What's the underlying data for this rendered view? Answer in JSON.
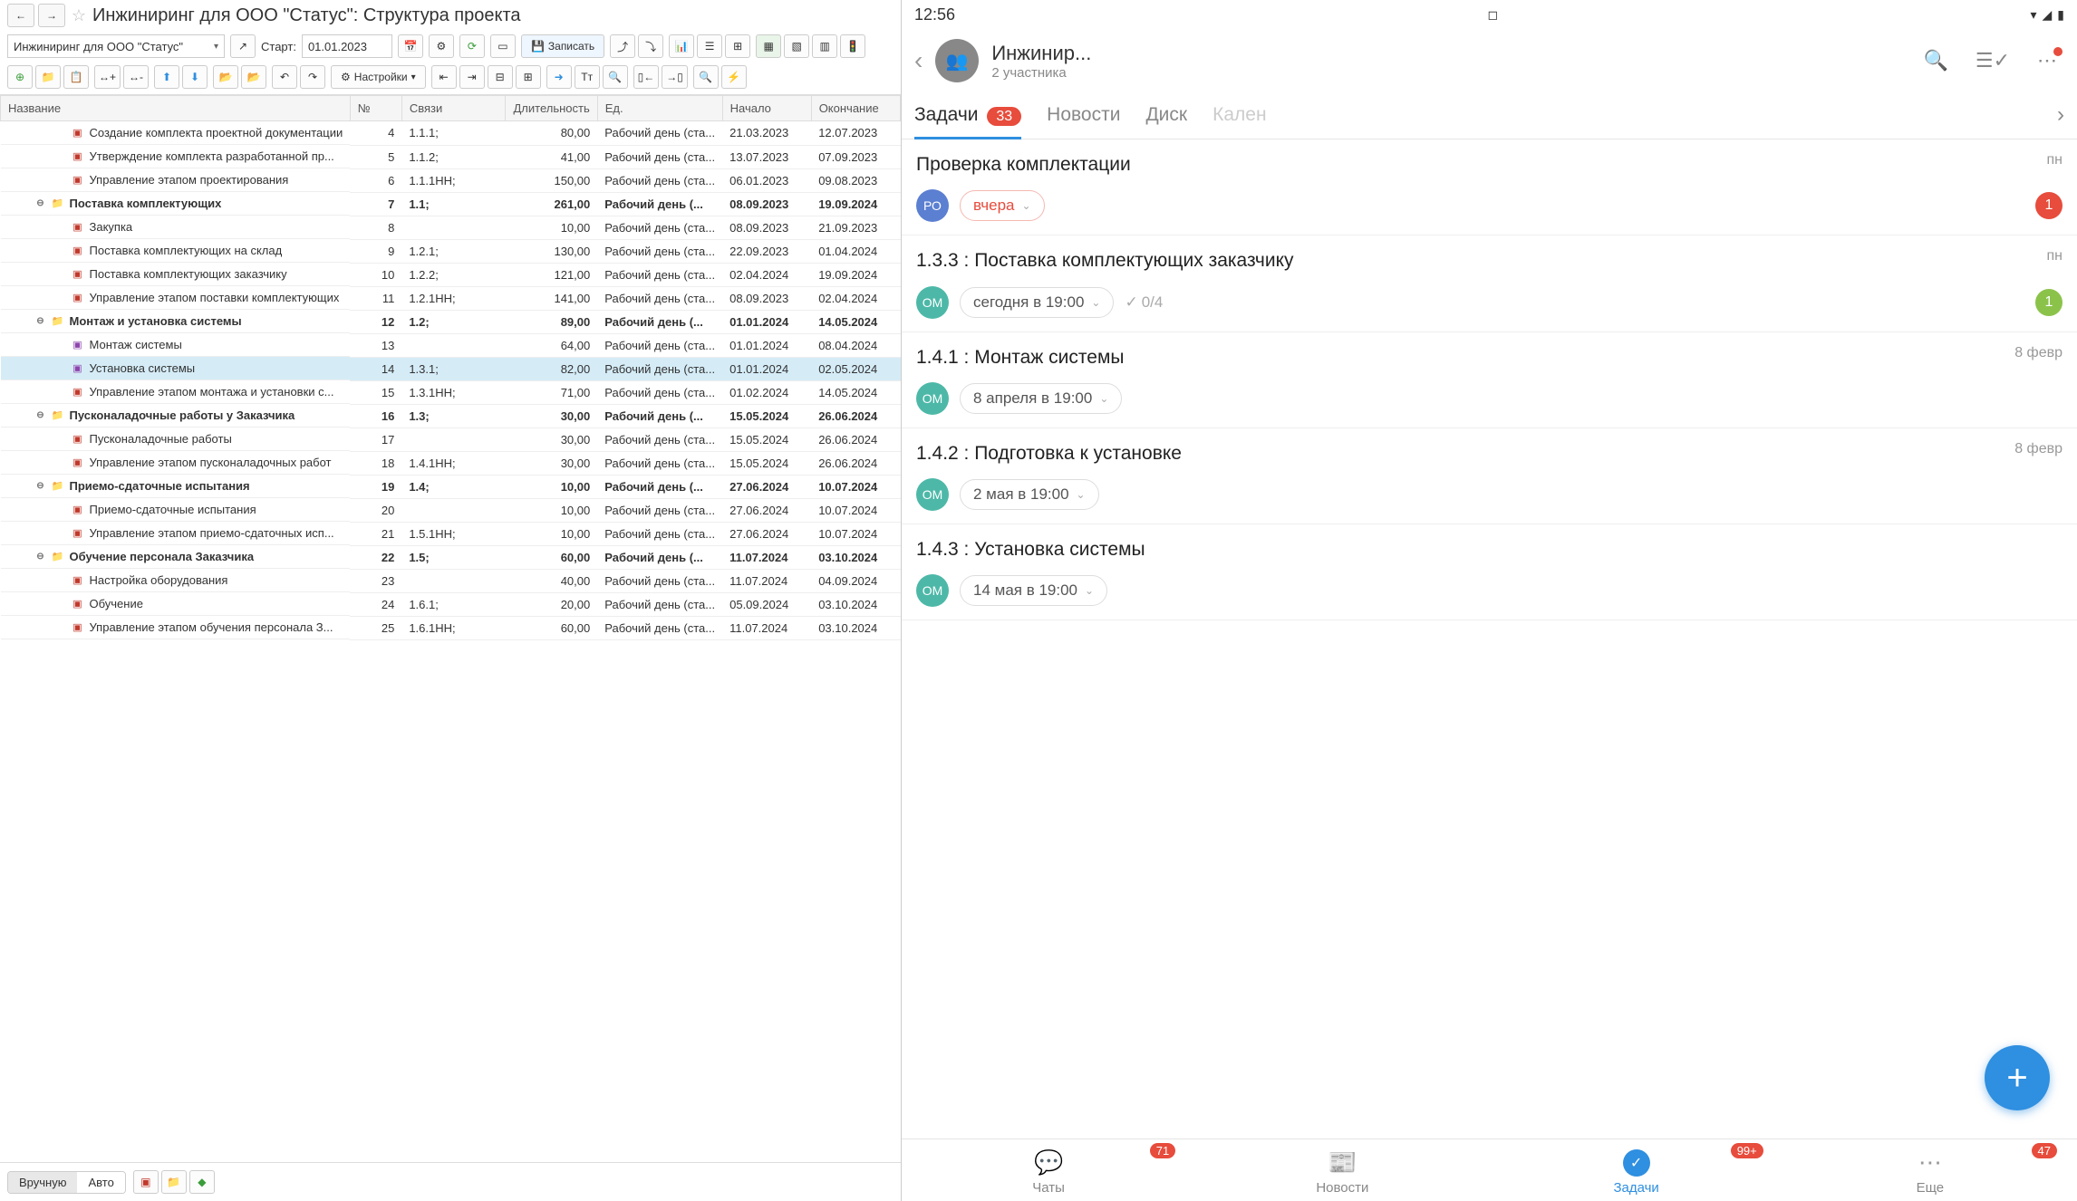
{
  "desktop": {
    "title": "Инжиниринг для ООО \"Статус\": Структура проекта",
    "project_select": "Инжиниринг для ООО \"Статус\"",
    "start_label": "Старт:",
    "start_date": "01.01.2023",
    "save_label": "Записать",
    "settings_label": "Настройки",
    "columns": {
      "name": "Название",
      "num": "№",
      "links": "Связи",
      "duration": "Длительность",
      "unit": "Ед.",
      "start": "Начало",
      "end": "Окончание"
    },
    "rows": [
      {
        "lvl": 2,
        "icon": "task",
        "name": "Создание комплекта проектной документации",
        "num": "4",
        "links": "1.1.1;",
        "dur": "80,00",
        "unit": "Рабочий день (ста...",
        "start": "21.03.2023",
        "end": "12.07.2023"
      },
      {
        "lvl": 2,
        "icon": "task",
        "name": "Утверждение комплекта разработанной пр...",
        "num": "5",
        "links": "1.1.2;",
        "dur": "41,00",
        "unit": "Рабочий день (ста...",
        "start": "13.07.2023",
        "end": "07.09.2023"
      },
      {
        "lvl": 2,
        "icon": "task",
        "name": "Управление этапом проектирования",
        "num": "6",
        "links": "1.1.1НН;",
        "dur": "150,00",
        "unit": "Рабочий день (ста...",
        "start": "06.01.2023",
        "end": "09.08.2023"
      },
      {
        "lvl": 1,
        "icon": "folder",
        "bold": true,
        "toggle": true,
        "name": "Поставка комплектующих",
        "num": "7",
        "links": "1.1;",
        "dur": "261,00",
        "unit": "Рабочий день (...",
        "start": "08.09.2023",
        "end": "19.09.2024"
      },
      {
        "lvl": 2,
        "icon": "task",
        "name": "Закупка",
        "num": "8",
        "links": "",
        "dur": "10,00",
        "unit": "Рабочий день (ста...",
        "start": "08.09.2023",
        "end": "21.09.2023"
      },
      {
        "lvl": 2,
        "icon": "task",
        "name": "Поставка комплектующих на склад",
        "num": "9",
        "links": "1.2.1;",
        "dur": "130,00",
        "unit": "Рабочий день (ста...",
        "start": "22.09.2023",
        "end": "01.04.2024"
      },
      {
        "lvl": 2,
        "icon": "task",
        "name": "Поставка комплектующих заказчику",
        "num": "10",
        "links": "1.2.2;",
        "dur": "121,00",
        "unit": "Рабочий день (ста...",
        "start": "02.04.2024",
        "end": "19.09.2024"
      },
      {
        "lvl": 2,
        "icon": "task",
        "name": "Управление этапом поставки комплектующих",
        "num": "11",
        "links": "1.2.1НН;",
        "dur": "141,00",
        "unit": "Рабочий день (ста...",
        "start": "08.09.2023",
        "end": "02.04.2024"
      },
      {
        "lvl": 1,
        "icon": "folder",
        "bold": true,
        "toggle": true,
        "name": "Монтаж и установка системы",
        "num": "12",
        "links": "1.2;",
        "dur": "89,00",
        "unit": "Рабочий день (...",
        "start": "01.01.2024",
        "end": "14.05.2024"
      },
      {
        "lvl": 2,
        "icon": "sub",
        "name": "Монтаж системы",
        "num": "13",
        "links": "",
        "dur": "64,00",
        "unit": "Рабочий день (ста...",
        "start": "01.01.2024",
        "end": "08.04.2024"
      },
      {
        "lvl": 2,
        "icon": "sub",
        "sel": true,
        "name": "Установка системы",
        "num": "14",
        "links": "1.3.1;",
        "dur": "82,00",
        "unit": "Рабочий день (ста...",
        "start": "01.01.2024",
        "end": "02.05.2024"
      },
      {
        "lvl": 2,
        "icon": "task",
        "name": "Управление этапом монтажа и установки с...",
        "num": "15",
        "links": "1.3.1НН;",
        "dur": "71,00",
        "unit": "Рабочий день (ста...",
        "start": "01.02.2024",
        "end": "14.05.2024"
      },
      {
        "lvl": 1,
        "icon": "folder",
        "bold": true,
        "toggle": true,
        "name": "Пусконаладочные работы у Заказчика",
        "num": "16",
        "links": "1.3;",
        "dur": "30,00",
        "unit": "Рабочий день (...",
        "start": "15.05.2024",
        "end": "26.06.2024"
      },
      {
        "lvl": 2,
        "icon": "task",
        "name": "Пусконаладочные работы",
        "num": "17",
        "links": "",
        "dur": "30,00",
        "unit": "Рабочий день (ста...",
        "start": "15.05.2024",
        "end": "26.06.2024"
      },
      {
        "lvl": 2,
        "icon": "task",
        "name": "Управление этапом пусконаладочных работ",
        "num": "18",
        "links": "1.4.1НН;",
        "dur": "30,00",
        "unit": "Рабочий день (ста...",
        "start": "15.05.2024",
        "end": "26.06.2024"
      },
      {
        "lvl": 1,
        "icon": "folder",
        "bold": true,
        "toggle": true,
        "name": "Приемо-сдаточные испытания",
        "num": "19",
        "links": "1.4;",
        "dur": "10,00",
        "unit": "Рабочий день (...",
        "start": "27.06.2024",
        "end": "10.07.2024"
      },
      {
        "lvl": 2,
        "icon": "task",
        "name": "Приемо-сдаточные испытания",
        "num": "20",
        "links": "",
        "dur": "10,00",
        "unit": "Рабочий день (ста...",
        "start": "27.06.2024",
        "end": "10.07.2024"
      },
      {
        "lvl": 2,
        "icon": "task",
        "name": "Управление этапом приемо-сдаточных исп...",
        "num": "21",
        "links": "1.5.1НН;",
        "dur": "10,00",
        "unit": "Рабочий день (ста...",
        "start": "27.06.2024",
        "end": "10.07.2024"
      },
      {
        "lvl": 1,
        "icon": "folder",
        "bold": true,
        "toggle": true,
        "name": "Обучение персонала Заказчика",
        "num": "22",
        "links": "1.5;",
        "dur": "60,00",
        "unit": "Рабочий день (...",
        "start": "11.07.2024",
        "end": "03.10.2024"
      },
      {
        "lvl": 2,
        "icon": "task",
        "name": "Настройка оборудования",
        "num": "23",
        "links": "",
        "dur": "40,00",
        "unit": "Рабочий день (ста...",
        "start": "11.07.2024",
        "end": "04.09.2024"
      },
      {
        "lvl": 2,
        "icon": "task",
        "name": "Обучение",
        "num": "24",
        "links": "1.6.1;",
        "dur": "20,00",
        "unit": "Рабочий день (ста...",
        "start": "05.09.2024",
        "end": "03.10.2024"
      },
      {
        "lvl": 2,
        "icon": "task",
        "name": "Управление этапом обучения персонала З...",
        "num": "25",
        "links": "1.6.1НН;",
        "dur": "60,00",
        "unit": "Рабочий день (ста...",
        "start": "11.07.2024",
        "end": "03.10.2024"
      }
    ],
    "footer": {
      "manual": "Вручную",
      "auto": "Авто"
    }
  },
  "mobile": {
    "status": {
      "time": "12:56"
    },
    "header": {
      "title": "Инжинир...",
      "sub": "2 участника"
    },
    "tabs": {
      "tasks": "Задачи",
      "tasks_badge": "33",
      "news": "Новости",
      "disk": "Диск",
      "calendar": "Кален"
    },
    "items": [
      {
        "title": "Проверка комплектации",
        "day": "пн",
        "av": "РО",
        "avc": "ro",
        "chip": "вчера",
        "chipRed": true,
        "badge": "1",
        "badgeColor": "red"
      },
      {
        "title": "1.3.3 : Поставка комплектующих заказчику",
        "day": "пн",
        "av": "ОМ",
        "avc": "om",
        "chip": "сегодня в 19:00",
        "count": "0/4",
        "badge": "1",
        "badgeColor": "green"
      },
      {
        "title": "1.4.1 : Монтаж системы",
        "day": "8 февр",
        "av": "ОМ",
        "avc": "om",
        "chip": "8 апреля в 19:00"
      },
      {
        "title": "1.4.2 : Подготовка к установке",
        "day": "8 февр",
        "av": "ОМ",
        "avc": "om",
        "chip": "2 мая в 19:00"
      },
      {
        "title": "1.4.3 : Установка системы",
        "day": "",
        "av": "ОМ",
        "avc": "om",
        "chip": "14 мая в 19:00"
      }
    ],
    "nav": {
      "chats": "Чаты",
      "chats_badge": "71",
      "news": "Новости",
      "tasks": "Задачи",
      "tasks_badge": "99+",
      "more": "Еще",
      "more_badge": "47"
    }
  }
}
